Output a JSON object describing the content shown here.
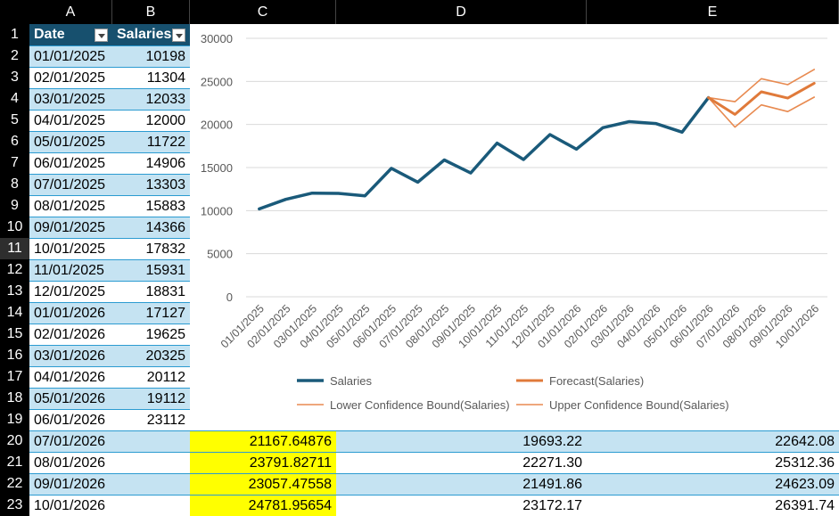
{
  "columns": [
    "A",
    "B",
    "C",
    "D",
    "E"
  ],
  "rows": [
    "1",
    "2",
    "3",
    "4",
    "5",
    "6",
    "7",
    "8",
    "9",
    "10",
    "11",
    "12",
    "13",
    "14",
    "15",
    "16",
    "17",
    "18",
    "19",
    "20",
    "21",
    "22",
    "23"
  ],
  "table_header": {
    "date": "Date",
    "salaries": "Salaries"
  },
  "data_rows": [
    {
      "date": "01/01/2025",
      "salary": "10198"
    },
    {
      "date": "02/01/2025",
      "salary": "11304"
    },
    {
      "date": "03/01/2025",
      "salary": "12033"
    },
    {
      "date": "04/01/2025",
      "salary": "12000"
    },
    {
      "date": "05/01/2025",
      "salary": "11722"
    },
    {
      "date": "06/01/2025",
      "salary": "14906"
    },
    {
      "date": "07/01/2025",
      "salary": "13303"
    },
    {
      "date": "08/01/2025",
      "salary": "15883"
    },
    {
      "date": "09/01/2025",
      "salary": "14366"
    },
    {
      "date": "10/01/2025",
      "salary": "17832"
    },
    {
      "date": "11/01/2025",
      "salary": "15931"
    },
    {
      "date": "12/01/2025",
      "salary": "18831"
    },
    {
      "date": "01/01/2026",
      "salary": "17127"
    },
    {
      "date": "02/01/2026",
      "salary": "19625"
    },
    {
      "date": "03/01/2026",
      "salary": "20325"
    },
    {
      "date": "04/01/2026",
      "salary": "20112"
    },
    {
      "date": "05/01/2026",
      "salary": "19112"
    },
    {
      "date": "06/01/2026",
      "salary": "23112"
    }
  ],
  "forecast_rows": [
    {
      "date": "07/01/2026",
      "forecast": "21167.64876",
      "lower": "19693.22",
      "upper": "22642.08"
    },
    {
      "date": "08/01/2026",
      "forecast": "23791.82711",
      "lower": "22271.30",
      "upper": "25312.36"
    },
    {
      "date": "09/01/2026",
      "forecast": "23057.47558",
      "lower": "21491.86",
      "upper": "24623.09"
    },
    {
      "date": "10/01/2026",
      "forecast": "24781.95654",
      "lower": "23172.17",
      "upper": "26391.74"
    }
  ],
  "colors": {
    "salaries": "#1a5a7a",
    "forecast": "#e07a3a",
    "bounds": "#e88a50",
    "band_blue": "#c5e3f2",
    "highlight": "#ffff00"
  },
  "chart_data": {
    "type": "line",
    "categories": [
      "01/01/2025",
      "02/01/2025",
      "03/01/2025",
      "04/01/2025",
      "05/01/2025",
      "06/01/2025",
      "07/01/2025",
      "08/01/2025",
      "09/01/2025",
      "10/01/2025",
      "11/01/2025",
      "12/01/2025",
      "01/01/2026",
      "02/01/2026",
      "03/01/2026",
      "04/01/2026",
      "05/01/2026",
      "06/01/2026",
      "07/01/2026",
      "08/01/2026",
      "09/01/2026",
      "10/01/2026"
    ],
    "ylim": [
      0,
      30000
    ],
    "yticks": [
      "0",
      "5000",
      "10000",
      "15000",
      "20000",
      "25000",
      "30000"
    ],
    "grid": true,
    "legend_position": "bottom",
    "series": [
      {
        "name": "Salaries",
        "values": [
          10198,
          11304,
          12033,
          12000,
          11722,
          14906,
          13303,
          15883,
          14366,
          17832,
          15931,
          18831,
          17127,
          19625,
          20325,
          20112,
          19112,
          23112,
          null,
          null,
          null,
          null
        ]
      },
      {
        "name": "Forecast(Salaries)",
        "values": [
          null,
          null,
          null,
          null,
          null,
          null,
          null,
          null,
          null,
          null,
          null,
          null,
          null,
          null,
          null,
          null,
          null,
          23112,
          21167.65,
          23791.83,
          23057.48,
          24781.96
        ]
      },
      {
        "name": "Lower Confidence Bound(Salaries)",
        "values": [
          null,
          null,
          null,
          null,
          null,
          null,
          null,
          null,
          null,
          null,
          null,
          null,
          null,
          null,
          null,
          null,
          null,
          23112,
          19693.22,
          22271.3,
          21491.86,
          23172.17
        ]
      },
      {
        "name": "Upper Confidence Bound(Salaries)",
        "values": [
          null,
          null,
          null,
          null,
          null,
          null,
          null,
          null,
          null,
          null,
          null,
          null,
          null,
          null,
          null,
          null,
          null,
          23112,
          22642.08,
          25312.36,
          24623.09,
          26391.74
        ]
      }
    ]
  }
}
